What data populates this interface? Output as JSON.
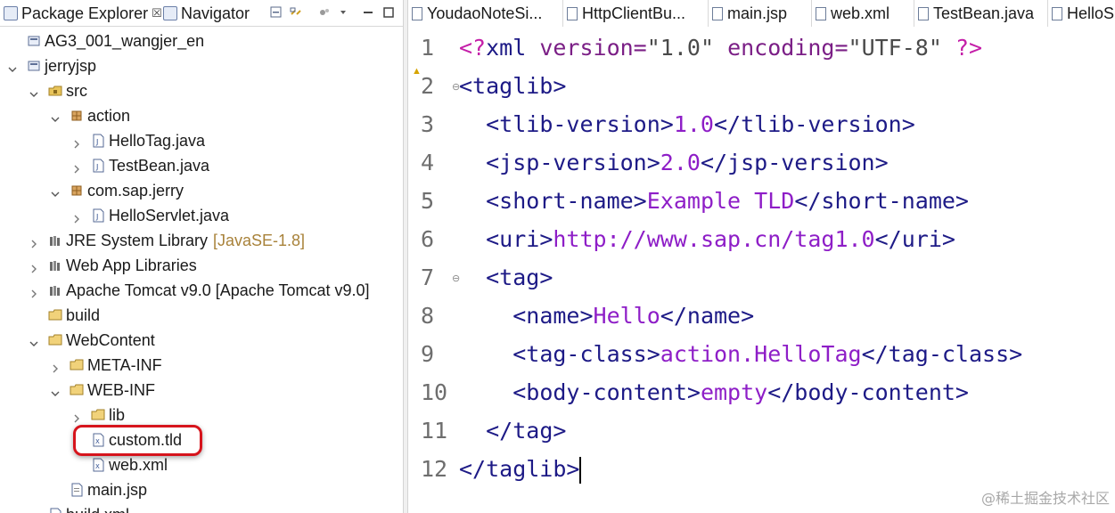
{
  "left_panel": {
    "tabs": [
      {
        "label": "Package Explorer",
        "close": "☒"
      },
      {
        "label": "Navigator"
      }
    ],
    "tree": [
      {
        "label": "AG3_001_wangjer_en",
        "icon": "project-icon",
        "indent": 0,
        "expand": "none"
      },
      {
        "label": "jerryjsp",
        "icon": "project-icon",
        "indent": 0,
        "expand": "open"
      },
      {
        "label": "src",
        "icon": "source-folder-icon",
        "indent": 1,
        "expand": "open"
      },
      {
        "label": "action",
        "icon": "package-icon",
        "indent": 2,
        "expand": "open"
      },
      {
        "label": "HelloTag.java",
        "icon": "java-file-icon",
        "indent": 3,
        "expand": "closed"
      },
      {
        "label": "TestBean.java",
        "icon": "java-file-icon",
        "indent": 3,
        "expand": "closed"
      },
      {
        "label": "com.sap.jerry",
        "icon": "package-icon",
        "indent": 2,
        "expand": "open"
      },
      {
        "label": "HelloServlet.java",
        "icon": "java-file-icon",
        "indent": 3,
        "expand": "closed"
      },
      {
        "label": "JRE System Library",
        "decoration": "[JavaSE-1.8]",
        "icon": "library-icon",
        "indent": 1,
        "expand": "closed"
      },
      {
        "label": "Web App Libraries",
        "icon": "library-icon",
        "indent": 1,
        "expand": "closed"
      },
      {
        "label": "Apache Tomcat v9.0 [Apache Tomcat v9.0]",
        "icon": "library-icon",
        "indent": 1,
        "expand": "closed"
      },
      {
        "label": "build",
        "icon": "folder-icon",
        "indent": 1,
        "expand": "none"
      },
      {
        "label": "WebContent",
        "icon": "folder-icon",
        "indent": 1,
        "expand": "open"
      },
      {
        "label": "META-INF",
        "icon": "folder-icon",
        "indent": 2,
        "expand": "closed"
      },
      {
        "label": "WEB-INF",
        "icon": "folder-icon",
        "indent": 2,
        "expand": "open"
      },
      {
        "label": "lib",
        "icon": "folder-icon",
        "indent": 3,
        "expand": "closed"
      },
      {
        "label": "custom.tld",
        "icon": "xml-file-icon",
        "indent": 3,
        "expand": "none",
        "highlighted": true
      },
      {
        "label": "web.xml",
        "icon": "xml-file-icon",
        "indent": 3,
        "expand": "none"
      },
      {
        "label": "main.jsp",
        "icon": "jsp-file-icon",
        "indent": 2,
        "expand": "none"
      },
      {
        "label": "build.xml",
        "icon": "xml-file-icon",
        "indent": 1,
        "expand": "none"
      }
    ]
  },
  "editor": {
    "tabs": [
      {
        "label": "YoudaoNoteSi..."
      },
      {
        "label": "HttpClientBu..."
      },
      {
        "label": "main.jsp"
      },
      {
        "label": "web.xml"
      },
      {
        "label": "TestBean.java"
      },
      {
        "label": "HelloS"
      }
    ],
    "line_numbers": [
      "1",
      "2",
      "3",
      "4",
      "5",
      "6",
      "7",
      "8",
      "9",
      "10",
      "11",
      "12"
    ],
    "lines": [
      {
        "indent": "",
        "parts": [
          [
            "pi",
            "<?"
          ],
          [
            "tag",
            "xml "
          ],
          [
            "attr",
            "version="
          ],
          [
            "str",
            "\"1.0\" "
          ],
          [
            "attr",
            "encoding="
          ],
          [
            "str",
            "\"UTF-8\" "
          ],
          [
            "pi",
            "?>"
          ]
        ]
      },
      {
        "indent": "",
        "parts": [
          [
            "tag",
            "<taglib>"
          ]
        ]
      },
      {
        "indent": "  ",
        "parts": [
          [
            "tag",
            "<tlib-version>"
          ],
          [
            "val",
            "1.0"
          ],
          [
            "tag",
            "</tlib-version>"
          ]
        ]
      },
      {
        "indent": "  ",
        "parts": [
          [
            "tag",
            "<jsp-version>"
          ],
          [
            "val",
            "2.0"
          ],
          [
            "tag",
            "</jsp-version>"
          ]
        ]
      },
      {
        "indent": "  ",
        "parts": [
          [
            "tag",
            "<short-name>"
          ],
          [
            "val",
            "Example TLD"
          ],
          [
            "tag",
            "</short-name>"
          ]
        ]
      },
      {
        "indent": "  ",
        "parts": [
          [
            "tag",
            "<uri>"
          ],
          [
            "val",
            "http://www.sap.cn/tag1.0"
          ],
          [
            "tag",
            "</uri>"
          ]
        ]
      },
      {
        "indent": "  ",
        "parts": [
          [
            "tag",
            "<tag>"
          ]
        ]
      },
      {
        "indent": "    ",
        "parts": [
          [
            "tag",
            "<name>"
          ],
          [
            "val",
            "Hello"
          ],
          [
            "tag",
            "</name>"
          ]
        ]
      },
      {
        "indent": "    ",
        "parts": [
          [
            "tag",
            "<tag-class>"
          ],
          [
            "val",
            "action.HelloTag"
          ],
          [
            "tag",
            "</tag-class>"
          ]
        ]
      },
      {
        "indent": "    ",
        "parts": [
          [
            "tag",
            "<body-content>"
          ],
          [
            "val",
            "empty"
          ],
          [
            "tag",
            "</body-content>"
          ]
        ]
      },
      {
        "indent": "  ",
        "parts": [
          [
            "tag",
            "</tag>"
          ]
        ]
      },
      {
        "indent": "",
        "parts": [
          [
            "tag",
            "</taglib>"
          ]
        ]
      }
    ],
    "fold_lines": [
      2,
      7
    ],
    "fold_marker": "⊖",
    "warning_marker": "▲"
  },
  "watermark": "@稀土掘金技术社区"
}
